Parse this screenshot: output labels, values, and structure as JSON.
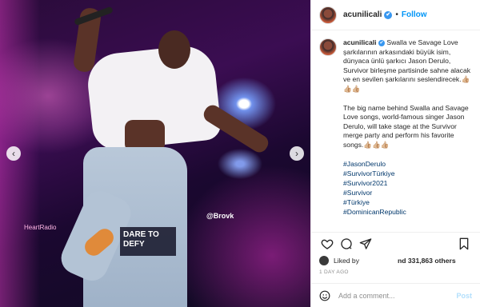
{
  "post": {
    "image_text": {
      "sign": "DARE TO DEFY",
      "handle": "@Brovk",
      "radio": "HeartRadio"
    }
  },
  "header": {
    "username": "acunilicali",
    "follow_label": "Follow",
    "separator": "•",
    "verified_icon": "✔"
  },
  "caption": {
    "username": "acunilicali",
    "text_tr": "Swalla ve Savage Love şarkılarının arkasındaki büyük isim, dünyaca ünlü şarkıcı Jason Derulo, Survivor birleşme partisinde sahne alacak ve en sevilen şarkılarını seslendirecek.👍🏼👍🏼👍🏼",
    "text_en": "The big name behind Swalla and Savage Love songs, world-famous singer Jason Derulo, will take stage at the Survivor merge party and perform his favorite songs.👍🏼👍🏼👍🏼",
    "hashtags": [
      "#JasonDerulo",
      "#SurvivorTürkiye",
      "#Survivor2021",
      "#Survivor",
      "#Türkiye",
      "#DominicanRepublic"
    ]
  },
  "likes": {
    "liked_by": "Liked by",
    "and_count": "nd 331,863 others"
  },
  "timestamp": "1 DAY AGO",
  "comment": {
    "placeholder": "Add a comment...",
    "post_label": "Post"
  },
  "nav": {
    "prev": "‹",
    "next": "›"
  },
  "colors": {
    "link": "#00376b",
    "follow": "#0095f6",
    "verified": "#3897f0"
  }
}
